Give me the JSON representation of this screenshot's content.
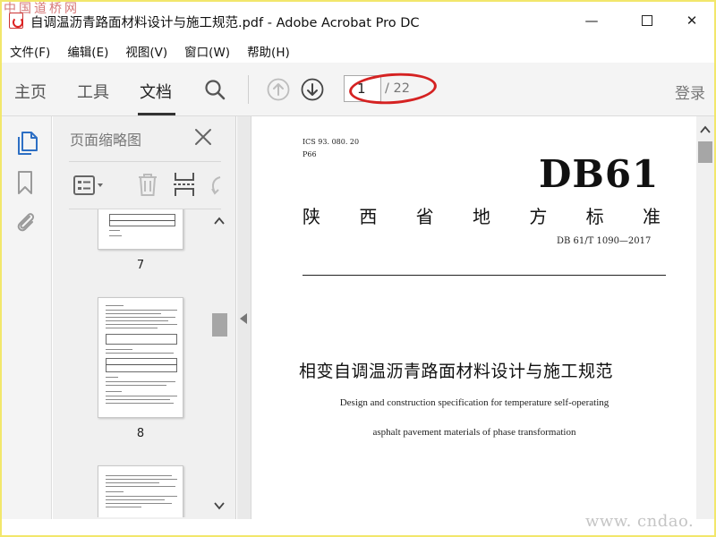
{
  "window": {
    "title": "自调温沥青路面材料设计与施工规范.pdf - Adobe Acrobat Pro DC",
    "minimize_glyph": "—",
    "close_glyph": "✕"
  },
  "menu": [
    "文件(F)",
    "编辑(E)",
    "视图(V)",
    "窗口(W)",
    "帮助(H)"
  ],
  "toolbar": {
    "tabs": [
      "主页",
      "工具",
      "文档"
    ],
    "active_tab": "文档",
    "current_page": "1",
    "total_pages": "/ 22",
    "login_label": "登录",
    "annotation_color": "#d52222"
  },
  "sidebar_icons": [
    "pages-icon",
    "bookmark-icon",
    "attachment-icon"
  ],
  "thumbnails": {
    "title": "页面缩略图",
    "pages": [
      {
        "label": "7"
      },
      {
        "label": "8"
      },
      {
        "label": ""
      }
    ]
  },
  "document": {
    "ics": "ICS 93. 080. 20",
    "category": "P66",
    "standard_prefix": "DB61",
    "province_chars": [
      "陕",
      "西",
      "省",
      "地",
      "方",
      "标",
      "准"
    ],
    "standard_code": "DB 61/T  1090—2017",
    "title_cn": "相变自调温沥青路面材料设计与施工规范",
    "title_en_line1": "Design and construction specification for temperature self-operating",
    "title_en_line2": "asphalt pavement materials of phase transformation"
  },
  "watermarks": {
    "top": "中国道桥网",
    "bottom": "www. cndao. com"
  },
  "colors": {
    "accent_blue": "#2d6fc4",
    "frame_yellow": "#f2e76b"
  }
}
